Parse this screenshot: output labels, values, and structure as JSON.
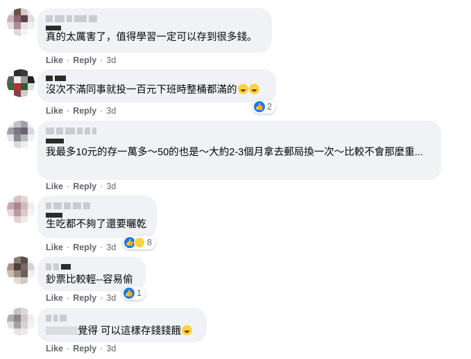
{
  "actions": {
    "like": "Like",
    "reply": "Reply",
    "dot": "·"
  },
  "comments": [
    {
      "text": "真的太厲害了，值得學習一定可以存到很多錢。",
      "time": "3d",
      "reactions": null
    },
    {
      "text": "沒次不滿同事就投一百元下班時整桶都滿的",
      "time": "3d",
      "reactions": "2"
    },
    {
      "text": "我最多10元的存一萬多～50的也是～大約2-3個月拿去郵局換一次～比較不會那麼重...",
      "time": "3d",
      "reactions": null
    },
    {
      "text": "生吃都不夠了還要曬乾",
      "time": "3d",
      "reactions": "8"
    },
    {
      "text": "鈔票比較輕--容易偷",
      "time": "3d",
      "reactions": "1"
    },
    {
      "text": "覺得 可以這樣存錢錢餓",
      "time": "3d",
      "reactions": null
    }
  ],
  "colors": {
    "bubble": "#f0f2f5",
    "like_blue": "#1877f2",
    "meta_gray": "#65676b"
  },
  "icons": [
    "thumbs-up-icon",
    "haha-emoji-icon"
  ]
}
